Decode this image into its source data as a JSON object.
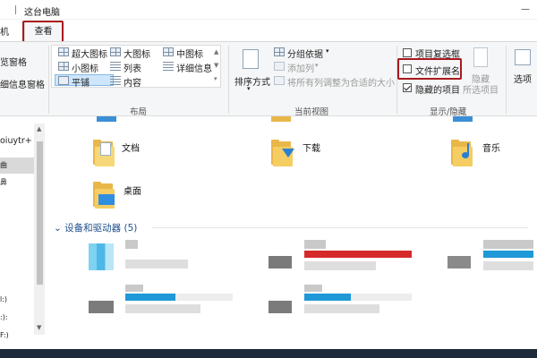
{
  "window": {
    "title": "这台电脑",
    "controls": "—"
  },
  "tabs": {
    "partial_left": "机",
    "view": "查看"
  },
  "ribbon": {
    "left_partial": [
      "览窗格",
      "细信息窗格"
    ],
    "layout": {
      "items": [
        {
          "label": "超大图标",
          "icon": "extra-large-icons-icon"
        },
        {
          "label": "大图标",
          "icon": "large-icons-icon"
        },
        {
          "label": "中图标",
          "icon": "medium-icons-icon"
        },
        {
          "label": "小图标",
          "icon": "small-icons-icon"
        },
        {
          "label": "列表",
          "icon": "list-icon"
        },
        {
          "label": "详细信息",
          "icon": "details-icon"
        },
        {
          "label": "平铺",
          "icon": "tiles-icon"
        },
        {
          "label": "内容",
          "icon": "content-icon"
        }
      ],
      "selected": "平铺",
      "group_label": "布局"
    },
    "current_view": {
      "sort_label": "排序方式",
      "group_by": "分组依据",
      "add_column": "添加列",
      "fit_columns": "将所有列调整为合适的大小",
      "group_label": "当前视图"
    },
    "show_hide": {
      "item_checkboxes": {
        "label": "项目复选框",
        "checked": false
      },
      "file_extensions": {
        "label": "文件扩展名",
        "checked": false
      },
      "hidden_items": {
        "label": "隐藏的项目",
        "checked": true
      },
      "hide_label": "隐藏",
      "hide_selected": "所选项目",
      "group_label": "显示/隐藏"
    },
    "options_label": "选项"
  },
  "nav": {
    "partial_item": "oiuytr+",
    "letters": [
      "曲",
      "鼻",
      "l:)",
      ":):",
      "F:)"
    ]
  },
  "content": {
    "folders": [
      "文档",
      "下载",
      "音乐",
      "桌面"
    ],
    "devices_header": "设备和驱动器 (5)"
  },
  "colors": {
    "highlight": "#a9191e",
    "accent_blue": "#1e98d6",
    "folder_yellow": "#f5cd63"
  }
}
